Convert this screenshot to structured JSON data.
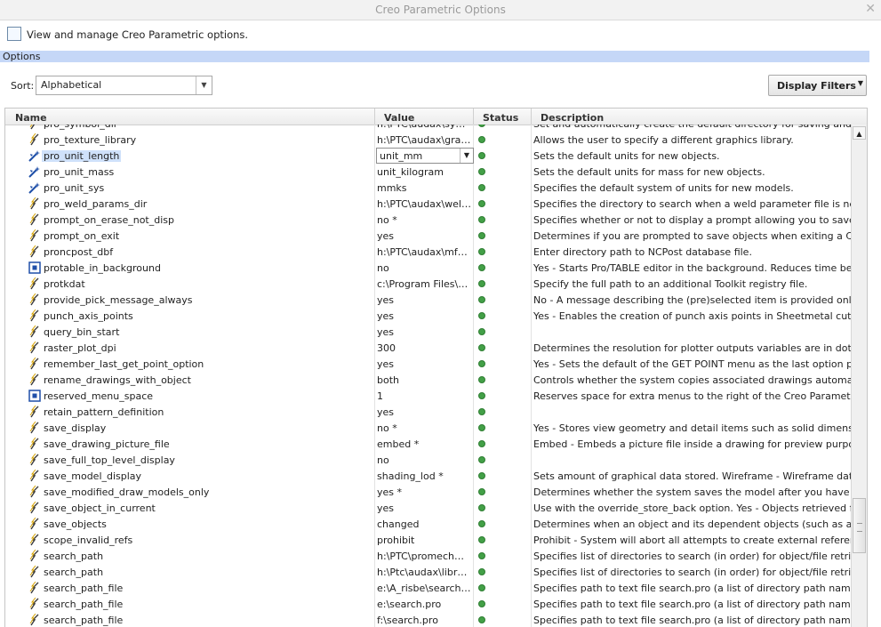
{
  "window": {
    "title": "Creo Parametric Options",
    "close_glyph": "✕"
  },
  "intro": {
    "text": "View and manage Creo Parametric options."
  },
  "options_bar": {
    "label": "Options"
  },
  "sort": {
    "label": "Sort:",
    "value": "Alphabetical"
  },
  "display_filters": {
    "label": "Display Filters"
  },
  "columns": {
    "name": "Name",
    "value": "Value",
    "status": "Status",
    "description": "Description"
  },
  "status_color": "#43a047",
  "rows": [
    {
      "icon": "lightning",
      "name": "pro_symbol_dir",
      "value": "h:\\PTC\\audax\\symbo...",
      "desc": "Set and automatically create the default directory for saving and retrieving"
    },
    {
      "icon": "lightning",
      "name": "pro_texture_library",
      "value": "h:\\PTC\\audax\\graphi...",
      "desc": "Allows the user to specify a different graphics library."
    },
    {
      "icon": "wand",
      "name": "pro_unit_length",
      "value": "unit_mm",
      "desc": "Sets the default units for new objects.",
      "selected": true
    },
    {
      "icon": "wand",
      "name": "pro_unit_mass",
      "value": "unit_kilogram",
      "desc": "Sets the default units for mass for new objects."
    },
    {
      "icon": "wand",
      "name": "pro_unit_sys",
      "value": "mmks",
      "desc": "Specifies the default system of units for new models."
    },
    {
      "icon": "lightning",
      "name": "pro_weld_params_dir",
      "value": "h:\\PTC\\audax\\weld_...",
      "desc": "Specifies the directory to search when a weld parameter file is needed."
    },
    {
      "icon": "lightning",
      "name": "prompt_on_erase_not_disp",
      "value": "no *",
      "desc": "Specifies whether or not to display a prompt allowing you to save your un"
    },
    {
      "icon": "lightning",
      "name": "prompt_on_exit",
      "value": "yes",
      "desc": "Determines if you are prompted to save objects when exiting a Creo Paran"
    },
    {
      "icon": "lightning",
      "name": "proncpost_dbf",
      "value": "h:\\PTC\\audax\\mfg_s...",
      "desc": "Enter directory path to NCPost database file."
    },
    {
      "icon": "box",
      "name": "protable_in_background",
      "value": "no",
      "desc": "Yes - Starts Pro/TABLE editor in the background. Reduces time between p"
    },
    {
      "icon": "lightning",
      "name": "protkdat",
      "value": "c:\\Program Files\\efx...",
      "desc": "Specify the full path to an additional Toolkit registry file."
    },
    {
      "icon": "lightning",
      "name": "provide_pick_message_always",
      "value": "yes",
      "desc": "No - A message describing the (pre)selected item is provided only while q"
    },
    {
      "icon": "lightning",
      "name": "punch_axis_points",
      "value": "yes",
      "desc": "Yes - Enables the creation of punch axis points in Sheetmetal cuts and pu"
    },
    {
      "icon": "lightning",
      "name": "query_bin_start",
      "value": "yes",
      "desc": ""
    },
    {
      "icon": "lightning",
      "name": "raster_plot_dpi",
      "value": "300",
      "desc": "Determines the resolution for plotter outputs variables are in dots per inch"
    },
    {
      "icon": "lightning",
      "name": "remember_last_get_point_option",
      "value": "yes",
      "desc": "Yes - Sets the default of the GET POINT menu as the last option picked am"
    },
    {
      "icon": "lightning",
      "name": "rename_drawings_with_object",
      "value": "both",
      "desc": "Controls whether the system copies associated drawings automatically w"
    },
    {
      "icon": "box",
      "name": "reserved_menu_space",
      "value": "1",
      "desc": "Reserves space for extra menus to the right of the Creo Parametric windo"
    },
    {
      "icon": "lightning",
      "name": "retain_pattern_definition",
      "value": "yes",
      "desc": ""
    },
    {
      "icon": "lightning",
      "name": "save_display",
      "value": "no *",
      "desc": "Yes - Stores view geometry and detail items such as solid dimensions. Th"
    },
    {
      "icon": "lightning",
      "name": "save_drawing_picture_file",
      "value": "embed *",
      "desc": "Embed - Embeds a picture file inside a drawing for preview purposes. Exp"
    },
    {
      "icon": "lightning",
      "name": "save_full_top_level_display",
      "value": "no",
      "desc": ""
    },
    {
      "icon": "lightning",
      "name": "save_model_display",
      "value": "shading_lod *",
      "desc": "Sets amount of graphical data stored. Wireframe - Wireframe data. Shadin"
    },
    {
      "icon": "lightning",
      "name": "save_modified_draw_models_only",
      "value": "yes *",
      "desc": "Determines whether the system saves the model after you have changed"
    },
    {
      "icon": "lightning",
      "name": "save_object_in_current",
      "value": "yes",
      "desc": "Use with the override_store_back option. Yes - Objects retrieved from a c"
    },
    {
      "icon": "lightning",
      "name": "save_objects",
      "value": "changed",
      "desc": "Determines when an object and its dependent objects (such as a part use"
    },
    {
      "icon": "lightning",
      "name": "scope_invalid_refs",
      "value": "prohibit",
      "desc": "Prohibit - System will abort all attempts to create external reference violati"
    },
    {
      "icon": "lightning",
      "name": "search_path",
      "value": "h:\\PTC\\promechWild...",
      "desc": "Specifies list of directories to search (in order) for object/file retrieval. The"
    },
    {
      "icon": "lightning",
      "name": "search_path",
      "value": "h:\\Ptc\\audax\\library_...",
      "desc": "Specifies list of directories to search (in order) for object/file retrieval. The"
    },
    {
      "icon": "lightning",
      "name": "search_path_file",
      "value": "e:\\A_risbe\\search.pro",
      "desc": "Specifies path to text file search.pro (a list of directory path names). The c"
    },
    {
      "icon": "lightning",
      "name": "search_path_file",
      "value": "e:\\search.pro",
      "desc": "Specifies path to text file search.pro (a list of directory path names). The c"
    },
    {
      "icon": "lightning",
      "name": "search_path_file",
      "value": "f:\\search.pro",
      "desc": "Specifies path to text file search.pro (a list of directory path names). The c"
    }
  ]
}
